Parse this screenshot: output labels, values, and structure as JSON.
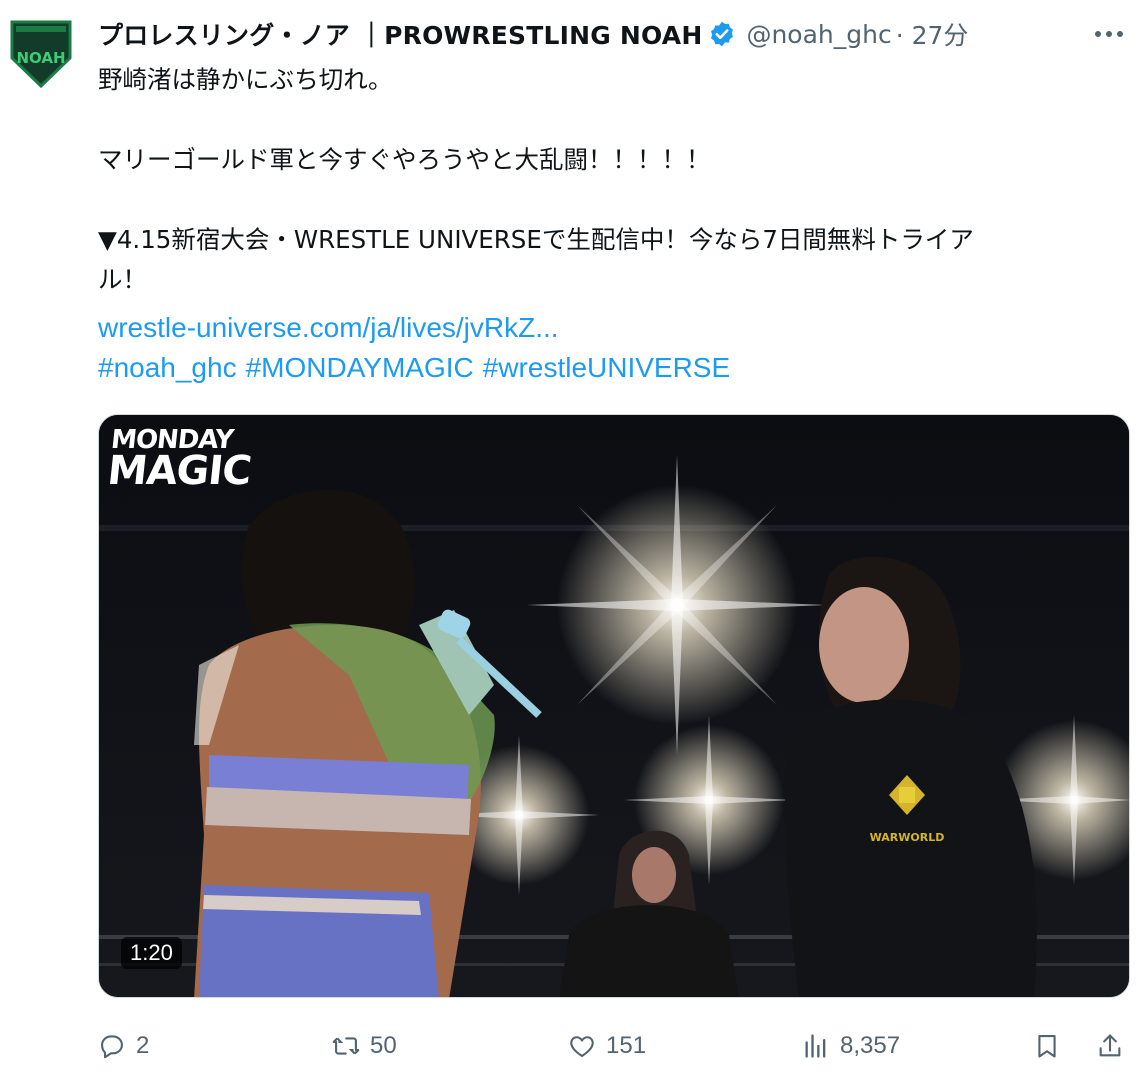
{
  "author": {
    "display_name": "プロレスリング・ノア ｜PROWRESTLING NOAH",
    "handle": "@noah_ghc",
    "time": "· 27分",
    "avatar_text": "NOAH"
  },
  "tweet": {
    "text": "野崎渚は静かにぶち切れ。\n\nマリーゴールド軍と今すぐやろうやと大乱闘！！！！！\n\n▼4.15新宿大会・WRESTLE UNIVERSEで生配信中！今なら7日間無料トライア\nル！",
    "link": "wrestle-universe.com/ja/lives/jvRkZ...",
    "hashtags": [
      "#noah_ghc",
      "#MONDAYMAGIC",
      "#wrestleUNIVERSE"
    ]
  },
  "media": {
    "watermark_line1": "MONDAY",
    "watermark_line2": "MAGIC",
    "duration": "1:20",
    "jacket_logo_text": "WARWORLD"
  },
  "actions": {
    "replies": "2",
    "retweets": "50",
    "likes": "151",
    "views": "8,357"
  },
  "colors": {
    "link": "#1d9bf0",
    "verified": "#1d9bf0",
    "muted": "#536471",
    "avatar_green": "#1c7a45"
  }
}
